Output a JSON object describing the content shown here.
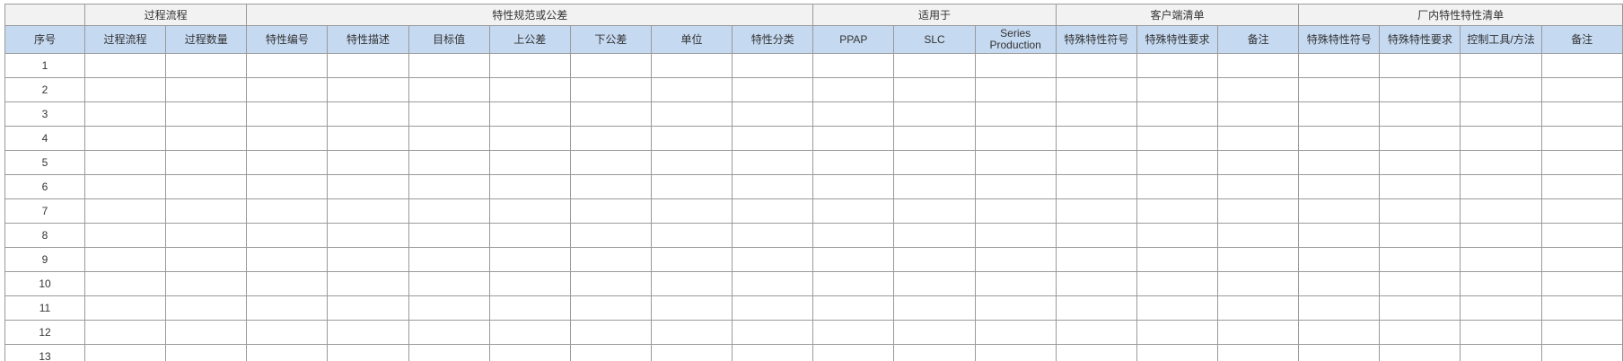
{
  "group_headers": [
    {
      "label": "",
      "span": 1
    },
    {
      "label": "过程流程",
      "span": 2
    },
    {
      "label": "特性规范或公差",
      "span": 7
    },
    {
      "label": "适用于",
      "span": 3
    },
    {
      "label": "客户端清单",
      "span": 3
    },
    {
      "label": "厂内特性特性清单",
      "span": 4
    }
  ],
  "column_headers": [
    "序号",
    "过程流程",
    "过程数量",
    "特性编号",
    "特性描述",
    "目标值",
    "上公差",
    "下公差",
    "单位",
    "特性分类",
    "PPAP",
    "SLC",
    "Series Production",
    "特殊特性符号",
    "特殊特性要求",
    "备注",
    "特殊特性符号",
    "特殊特性要求",
    "控制工具/方法",
    "备注"
  ],
  "rows": [
    "1",
    "2",
    "3",
    "4",
    "5",
    "6",
    "7",
    "8",
    "9",
    "10",
    "11",
    "12",
    "13"
  ]
}
